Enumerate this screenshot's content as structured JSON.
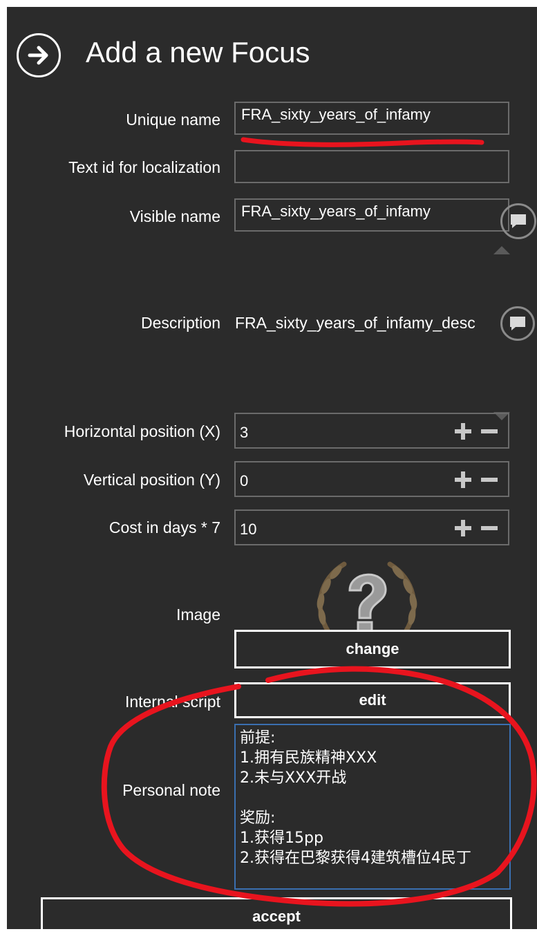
{
  "header": {
    "title": "Add a new Focus",
    "back_icon": "arrow-right-circle-icon"
  },
  "fields": {
    "unique_name": {
      "label": "Unique name",
      "value": "FRA_sixty_years_of_infamy"
    },
    "text_id": {
      "label": "Text id for localization",
      "value": ""
    },
    "visible_name": {
      "label": "Visible name",
      "value": "FRA_sixty_years_of_infamy"
    },
    "description": {
      "label": "Description",
      "value": "FRA_sixty_years_of_infamy_desc"
    },
    "x": {
      "label": "Horizontal position (X)",
      "value": "3"
    },
    "y": {
      "label": "Vertical position (Y)",
      "value": "0"
    },
    "cost": {
      "label": "Cost in days * 7",
      "value": "10"
    }
  },
  "image": {
    "label": "Image",
    "icon": "question-mark-laurel-icon",
    "change_label": "change"
  },
  "script": {
    "label": "Internal script",
    "edit_label": "edit"
  },
  "note": {
    "label": "Personal note",
    "text": "前提:\n1.拥有民族精神XXX\n2.未与XXX开战\n\n奖励:\n1.获得15pp\n2.获得在巴黎获得4建筑槽位4民丁"
  },
  "footer": {
    "accept_label": "accept"
  },
  "colors": {
    "background": "#2b2b2b",
    "border": "#6b6b6b",
    "annotation": "#e8141e",
    "focus_border": "#3a6fb0"
  }
}
